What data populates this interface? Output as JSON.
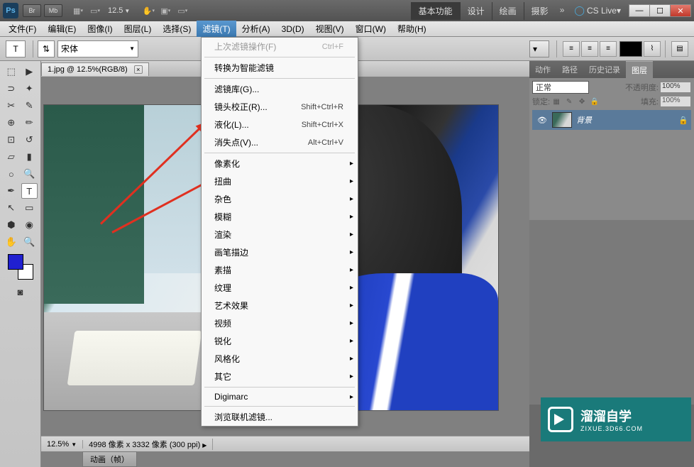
{
  "titlebar": {
    "logo": "Ps",
    "br": "Br",
    "mb": "Mb",
    "zoom": "12.5",
    "workspaces": [
      "基本功能",
      "设计",
      "绘画",
      "摄影"
    ],
    "cslive": "CS Live"
  },
  "menubar": [
    "文件(F)",
    "编辑(E)",
    "图像(I)",
    "图层(L)",
    "选择(S)",
    "滤镜(T)",
    "分析(A)",
    "3D(D)",
    "视图(V)",
    "窗口(W)",
    "帮助(H)"
  ],
  "menubar_active_index": 5,
  "optbar": {
    "tool": "T",
    "orient": "⇵",
    "font": "宋体",
    "color_swatch": "#000"
  },
  "doc": {
    "tab_label": "1.jpg @ 12.5%(RGB/8)"
  },
  "dropdown": [
    {
      "label": "上次滤镜操作(F)",
      "shortcut": "Ctrl+F",
      "disabled": true
    },
    {
      "sep": true
    },
    {
      "label": "转换为智能滤镜"
    },
    {
      "sep": true
    },
    {
      "label": "滤镜库(G)..."
    },
    {
      "label": "镜头校正(R)...",
      "shortcut": "Shift+Ctrl+R"
    },
    {
      "label": "液化(L)...",
      "shortcut": "Shift+Ctrl+X"
    },
    {
      "label": "消失点(V)...",
      "shortcut": "Alt+Ctrl+V"
    },
    {
      "sep": true
    },
    {
      "label": "像素化",
      "sub": true
    },
    {
      "label": "扭曲",
      "sub": true
    },
    {
      "label": "杂色",
      "sub": true
    },
    {
      "label": "模糊",
      "sub": true
    },
    {
      "label": "渲染",
      "sub": true
    },
    {
      "label": "画笔描边",
      "sub": true
    },
    {
      "label": "素描",
      "sub": true
    },
    {
      "label": "纹理",
      "sub": true
    },
    {
      "label": "艺术效果",
      "sub": true
    },
    {
      "label": "视频",
      "sub": true
    },
    {
      "label": "锐化",
      "sub": true
    },
    {
      "label": "风格化",
      "sub": true
    },
    {
      "label": "其它",
      "sub": true
    },
    {
      "sep": true
    },
    {
      "label": "Digimarc",
      "sub": true
    },
    {
      "sep": true
    },
    {
      "label": "浏览联机滤镜..."
    }
  ],
  "panels": {
    "top_tabs": [
      "动作",
      "路径",
      "历史记录",
      "图层"
    ],
    "active_top_tab": 3,
    "blend_mode": "正常",
    "opacity_label": "不透明度:",
    "opacity_value": "100%",
    "lock_label": "锁定:",
    "fill_label": "填充:",
    "fill_value": "100%",
    "layer_name": "背景"
  },
  "status": {
    "zoom": "12.5%",
    "info": "4998 像素 x 3332 像素 (300 ppi)",
    "bottom_tab": "动画（帧）"
  },
  "watermark": {
    "cn": "溜溜自学",
    "en": "ZIXUE.3D66.COM"
  }
}
